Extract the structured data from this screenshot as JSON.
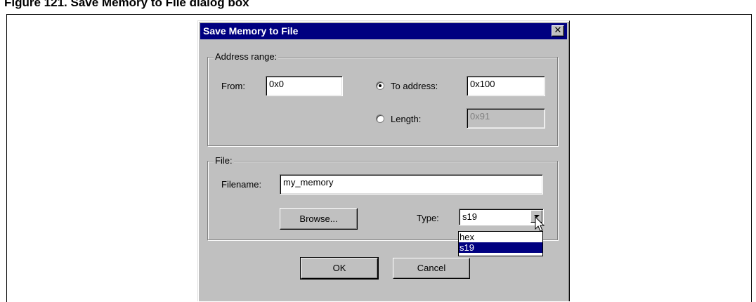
{
  "caption": "Figure 121. Save Memory to File dialog box",
  "dialog": {
    "title": "Save Memory to File",
    "close_icon": "close-icon",
    "address_range": {
      "group_label": "Address range:",
      "from_label": "From:",
      "from_value": "0x0",
      "to_address_label": "To address:",
      "to_address_value": "0x100",
      "to_address_selected": true,
      "length_label": "Length:",
      "length_value": "0x91",
      "length_selected": false
    },
    "file": {
      "group_label": "File:",
      "filename_label": "Filename:",
      "filename_value": "my_memory",
      "browse_label": "Browse...",
      "type_label": "Type:",
      "type_value": "s19",
      "type_options": [
        "hex",
        "s19"
      ],
      "type_selected_index": 1
    },
    "ok_label": "OK",
    "cancel_label": "Cancel"
  },
  "colors": {
    "titlebar": "#000080",
    "dialog_bg": "#c0c0c0",
    "selection": "#000080"
  }
}
